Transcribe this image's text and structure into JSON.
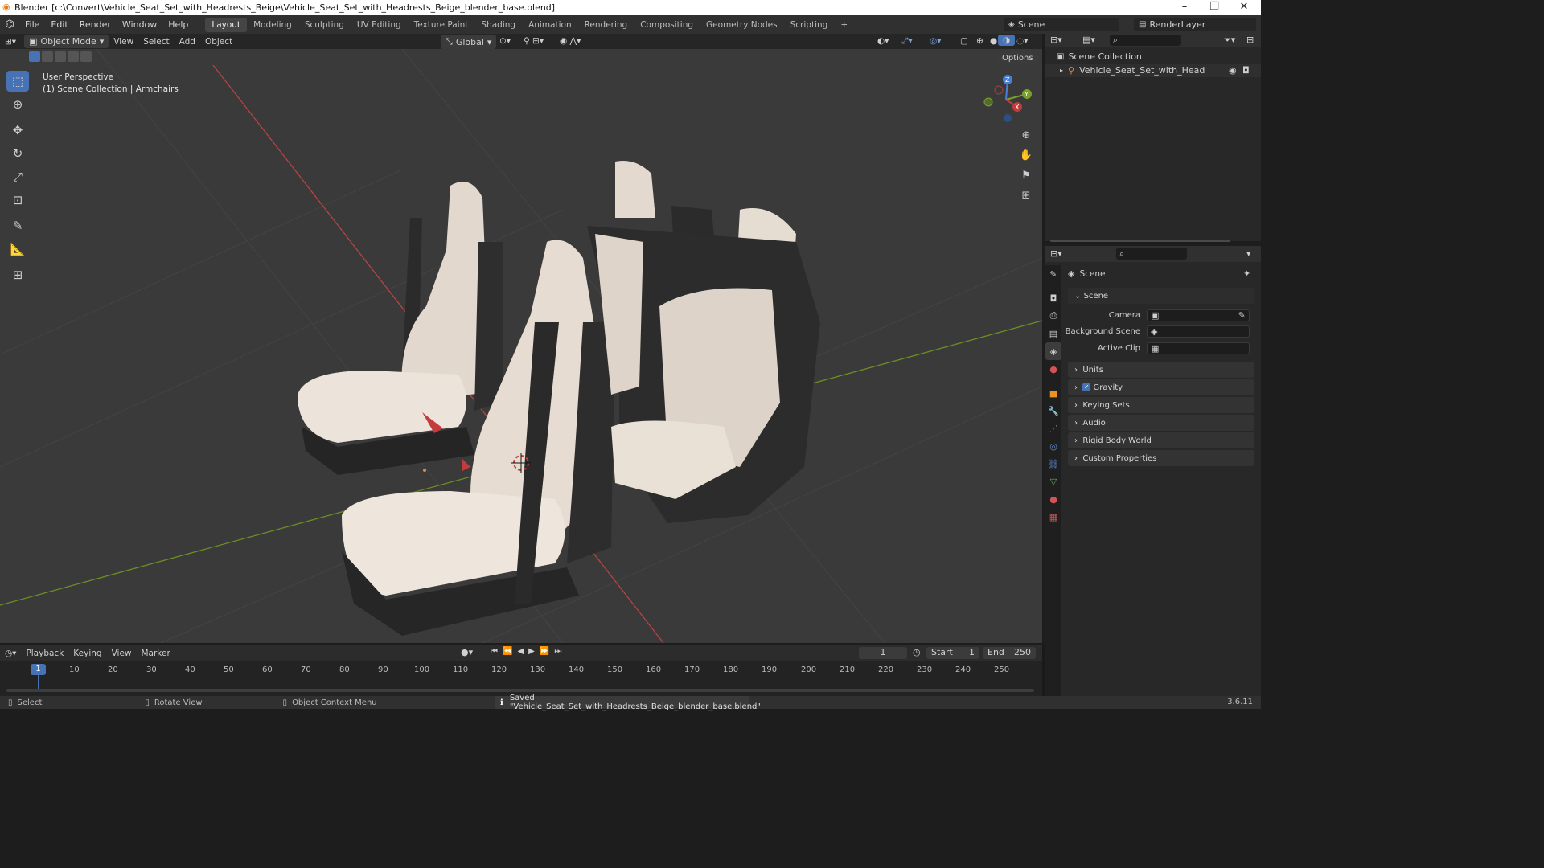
{
  "window": {
    "title": "Blender [c:\\Convert\\Vehicle_Seat_Set_with_Headrests_Beige\\Vehicle_Seat_Set_with_Headrests_Beige_blender_base.blend]",
    "minimize": "–",
    "maximize": "❐",
    "close": "✕"
  },
  "menus": [
    "File",
    "Edit",
    "Render",
    "Window",
    "Help"
  ],
  "workspaces": [
    "Layout",
    "Modeling",
    "Sculpting",
    "UV Editing",
    "Texture Paint",
    "Shading",
    "Animation",
    "Rendering",
    "Compositing",
    "Geometry Nodes",
    "Scripting",
    "+"
  ],
  "active_workspace": "Layout",
  "scene_selector": {
    "value": "Scene"
  },
  "view_layer": {
    "value": "RenderLayer"
  },
  "viewport_header": {
    "mode": "Object Mode",
    "items": [
      "View",
      "Select",
      "Add",
      "Object"
    ],
    "orientation": "Global",
    "options": "Options"
  },
  "viewport_overlay": {
    "line1": "User Perspective",
    "line2": "(1) Scene Collection | Armchairs"
  },
  "gizmo": {
    "x": "X",
    "y": "Y",
    "z": "Z"
  },
  "outliner": {
    "root": "Scene Collection",
    "items": [
      "Vehicle_Seat_Set_with_Headrests_Beige"
    ]
  },
  "properties": {
    "header": "Scene",
    "section": "Scene",
    "fields": [
      {
        "label": "Camera",
        "value": ""
      },
      {
        "label": "Background Scene",
        "value": ""
      },
      {
        "label": "Active Clip",
        "value": ""
      }
    ],
    "panels": [
      "Units",
      "Gravity",
      "Keying Sets",
      "Audio",
      "Rigid Body World",
      "Custom Properties"
    ],
    "gravity_checked": true
  },
  "timeline": {
    "menus": [
      "Playback",
      "Keying",
      "View",
      "Marker"
    ],
    "current_frame": "1",
    "start_label": "Start",
    "start": "1",
    "end_label": "End",
    "end": "250",
    "ticks": [
      "1",
      "10",
      "20",
      "30",
      "40",
      "50",
      "60",
      "70",
      "80",
      "90",
      "100",
      "110",
      "120",
      "130",
      "140",
      "150",
      "160",
      "170",
      "180",
      "190",
      "200",
      "210",
      "220",
      "230",
      "240",
      "250"
    ]
  },
  "statusbar": {
    "select": "Select",
    "rotate": "Rotate View",
    "context": "Object Context Menu",
    "message": "Saved \"Vehicle_Seat_Set_with_Headrests_Beige_blender_base.blend\"",
    "version": "3.6.11"
  },
  "colors": {
    "accent": "#4772b3",
    "x_axis": "#b54444",
    "y_axis": "#6b8e23",
    "seat_beige": "#e8dfd5",
    "seat_dark": "#2a2a2a"
  }
}
